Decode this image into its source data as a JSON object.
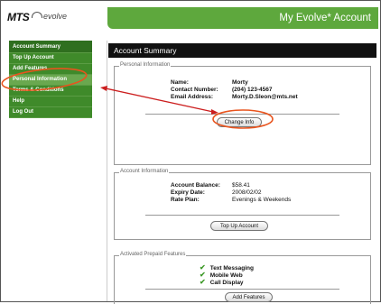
{
  "header": {
    "logo_mts": "MTS",
    "logo_evolve": "evolve",
    "account_title": "My Evolve* Account"
  },
  "sidebar": {
    "items": [
      {
        "label": "Account Summary"
      },
      {
        "label": "Top Up Account"
      },
      {
        "label": "Add Features"
      },
      {
        "label": "Personal Information"
      },
      {
        "label": "Terms & Conditions"
      },
      {
        "label": "Help"
      },
      {
        "label": "Log Out"
      }
    ]
  },
  "main": {
    "title": "Account Summary",
    "personal": {
      "legend": "Personal Information",
      "name_label": "Name:",
      "name_value": "Morty",
      "contact_label": "Contact Number:",
      "contact_value": "(204) 123-4567",
      "email_label": "Email Address:",
      "email_value": "Morty.D.Sleon@mts.net",
      "button": "Change Info"
    },
    "account": {
      "legend": "Account Information",
      "balance_label": "Account Balance:",
      "balance_value": "$58.41",
      "expiry_label": "Expiry Date:",
      "expiry_value": "2008/02/02",
      "rate_label": "Rate Plan:",
      "rate_value": "Evenings & Weekends",
      "button": "Top Up Account"
    },
    "features": {
      "legend": "Activated Prepaid Features",
      "items": [
        "Text Messaging",
        "Mobile Web",
        "Call Display"
      ],
      "button": "Add Features"
    }
  },
  "colors": {
    "brand_green": "#5ea83d",
    "nav_green": "#3f8a2a",
    "annotation_orange": "#e8541e",
    "annotation_red": "#cc1f1f"
  }
}
